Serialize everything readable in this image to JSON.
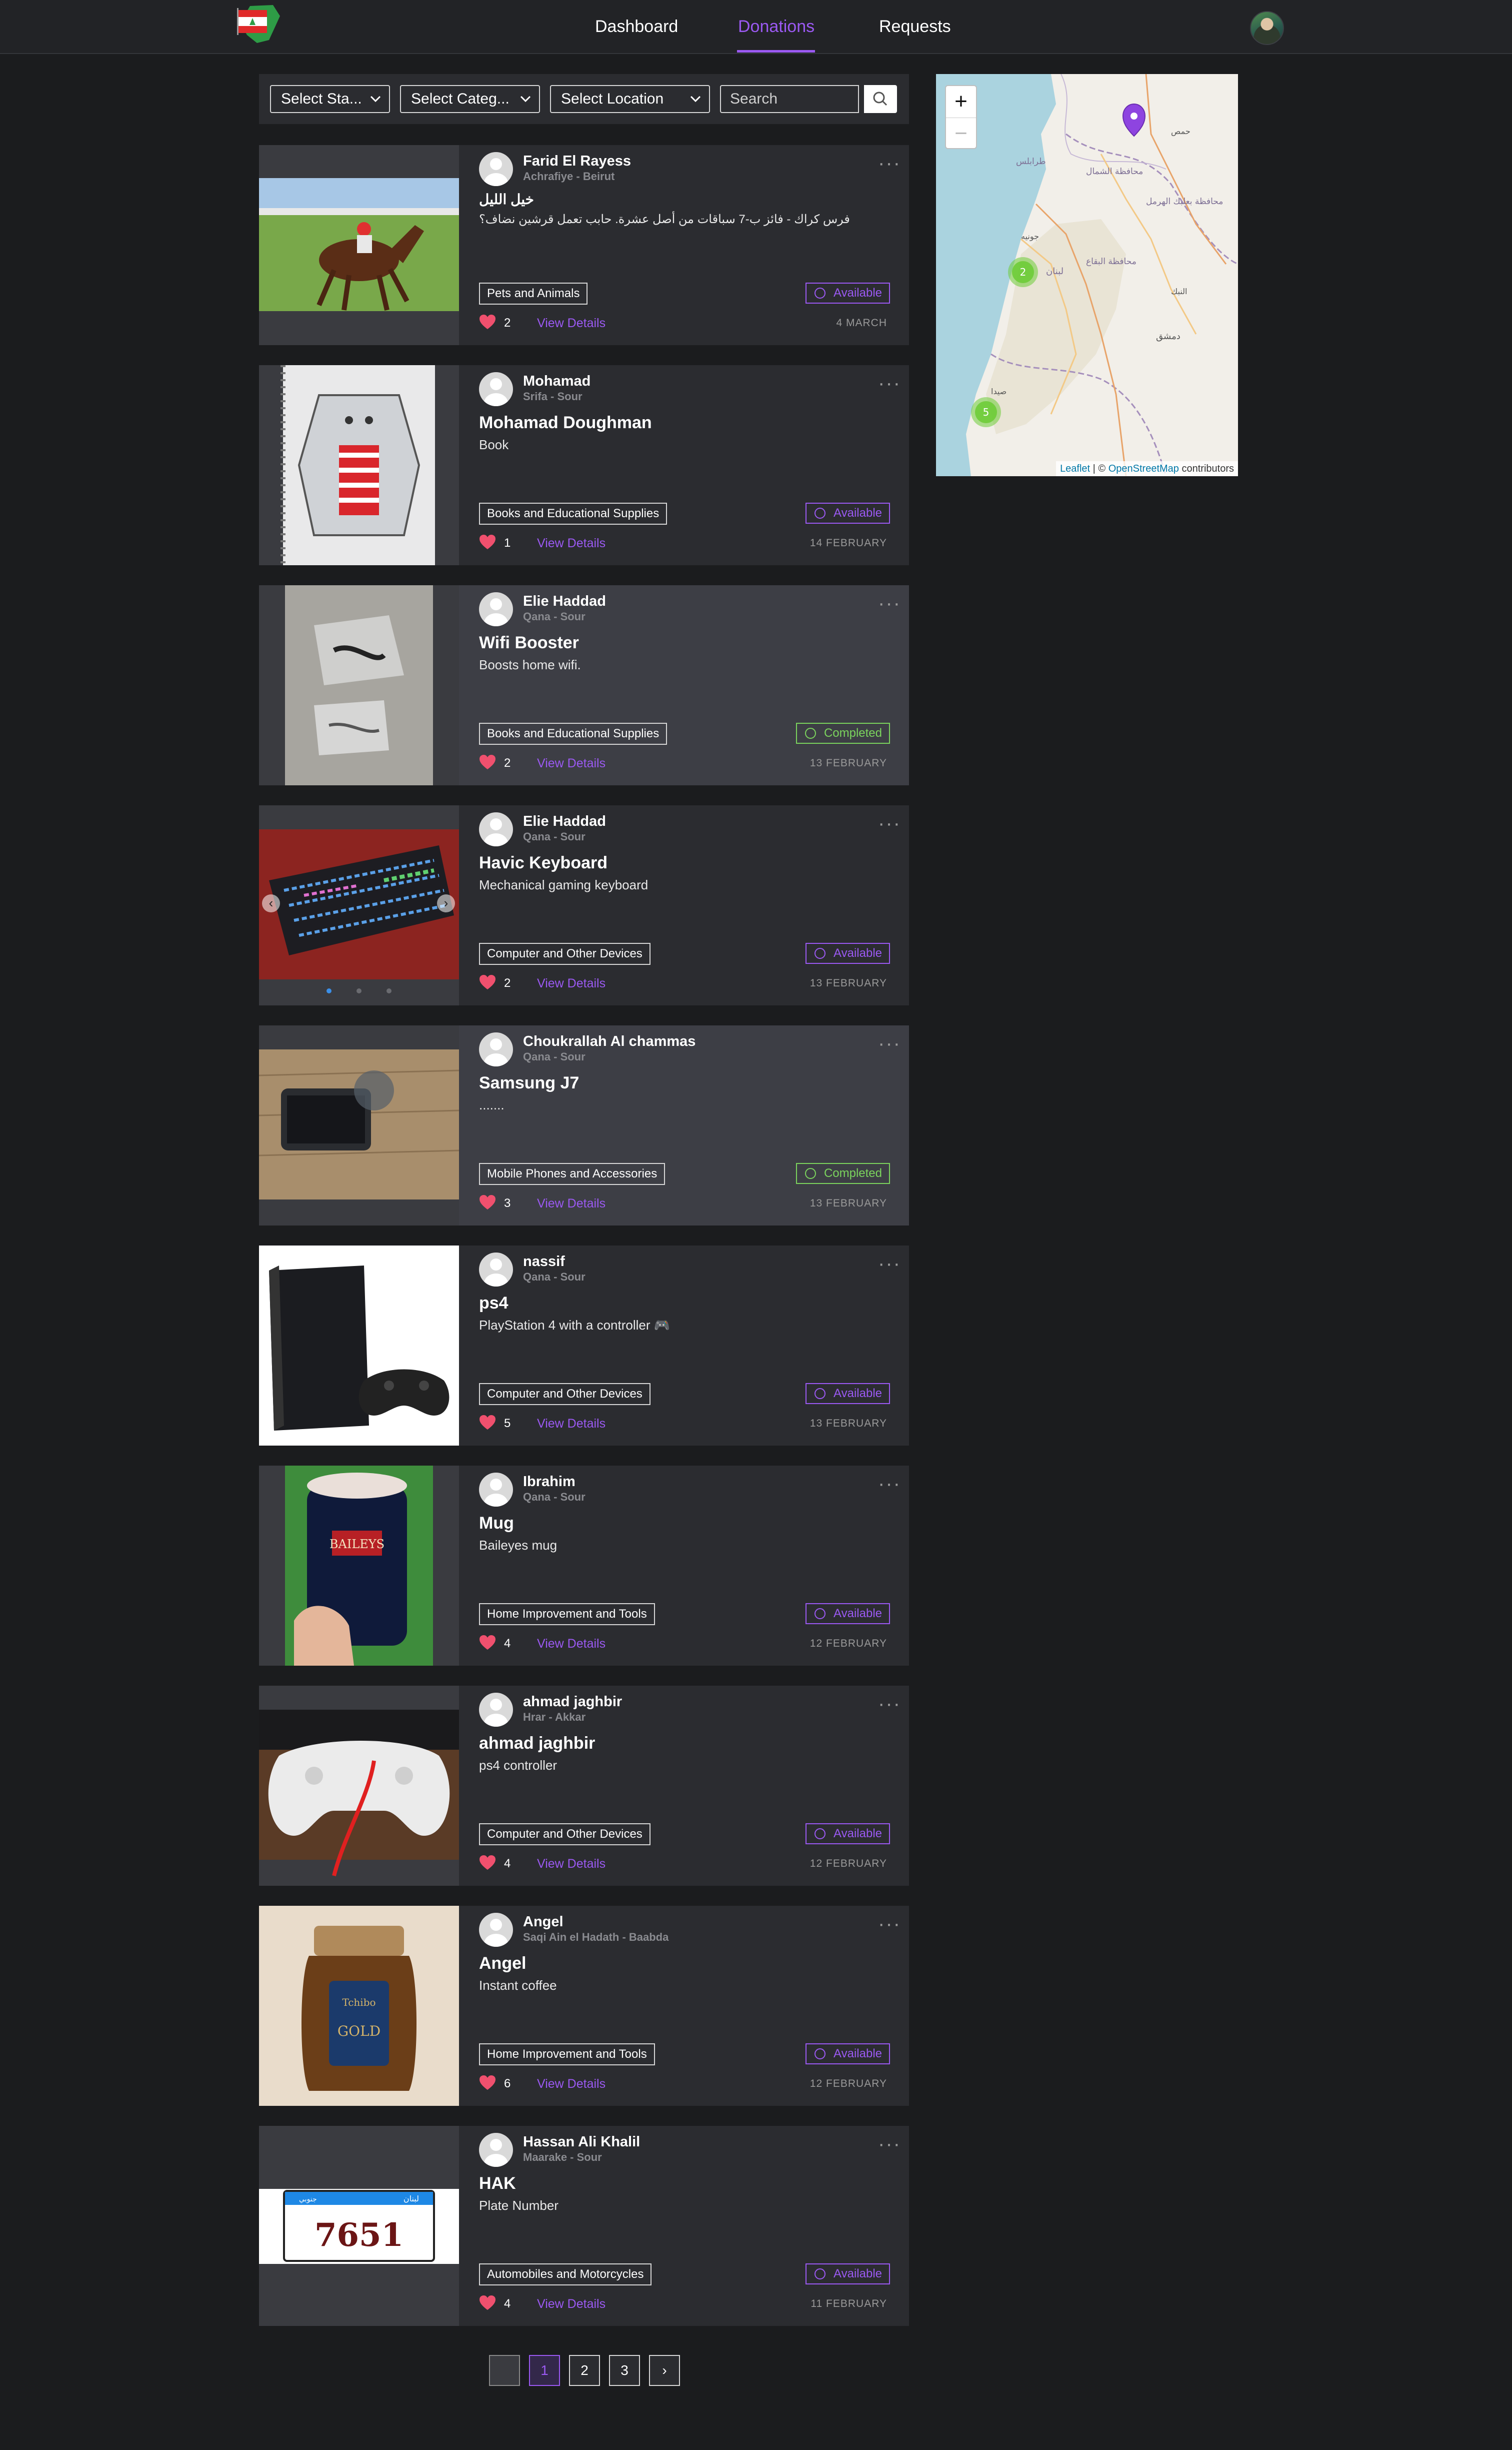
{
  "nav": {
    "links": [
      "Dashboard",
      "Donations",
      "Requests"
    ],
    "active": "Donations"
  },
  "filters": {
    "status_label": "Select Sta...",
    "category_label": "Select Categ...",
    "location_label": "Select Location",
    "search_placeholder": "Search"
  },
  "map": {
    "zoom_in": "+",
    "zoom_out": "−",
    "cluster_counts": [
      "2",
      "5"
    ],
    "attribution": {
      "leaflet": "Leaflet",
      "sep": " | © ",
      "osm": "OpenStreetMap",
      "suffix": " contributors"
    },
    "place_labels": [
      "لبنان",
      "دمشق",
      "محافظة الشمال",
      "محافظة بعلبك الهرمل",
      "محافظة البقاع",
      "جونيه",
      "طرابلس",
      "صيدا",
      "النبك",
      "حمص"
    ]
  },
  "donations": [
    {
      "user": "Farid El Rayess",
      "location": "Achrafiye - Beirut",
      "title": "خيل الليل",
      "description": "فرس كراك - فائز ب-7 سباقات من أصل عشرة. حابب تعمل قرشين نضاف؟",
      "category": "Pets and Animals",
      "status": "Available",
      "likes": "2",
      "date": "4 MARCH",
      "action": "View Details"
    },
    {
      "user": "Mohamad",
      "location": "Srifa - Sour",
      "title": "Mohamad Doughman",
      "description": "Book",
      "category": "Books and Educational Supplies",
      "status": "Available",
      "likes": "1",
      "date": "14 FEBRUARY",
      "action": "View Details"
    },
    {
      "user": "Elie Haddad",
      "location": "Qana - Sour",
      "title": "Wifi Booster",
      "description": "Boosts home wifi.",
      "category": "Books and Educational Supplies",
      "status": "Completed",
      "likes": "2",
      "date": "13 FEBRUARY",
      "action": "View Details"
    },
    {
      "user": "Elie Haddad",
      "location": "Qana - Sour",
      "title": "Havic Keyboard",
      "description": "Mechanical gaming keyboard",
      "category": "Computer and Other Devices",
      "status": "Available",
      "likes": "2",
      "date": "13 FEBRUARY",
      "action": "View Details"
    },
    {
      "user": "Choukrallah Al chammas",
      "location": "Qana - Sour",
      "title": "Samsung J7",
      "description": ".......",
      "category": "Mobile Phones and Accessories",
      "status": "Completed",
      "likes": "3",
      "date": "13 FEBRUARY",
      "action": "View Details"
    },
    {
      "user": "nassif",
      "location": "Qana - Sour",
      "title": "ps4",
      "description": "PlayStation 4 with a controller 🎮",
      "category": "Computer and Other Devices",
      "status": "Available",
      "likes": "5",
      "date": "13 FEBRUARY",
      "action": "View Details"
    },
    {
      "user": "Ibrahim",
      "location": "Qana - Sour",
      "title": "Mug",
      "description": "Baileyes mug",
      "category": "Home Improvement and Tools",
      "status": "Available",
      "likes": "4",
      "date": "12 FEBRUARY",
      "action": "View Details"
    },
    {
      "user": "ahmad jaghbir",
      "location": "Hrar - Akkar",
      "title": "ahmad jaghbir",
      "description": "ps4 controller",
      "category": "Computer and Other Devices",
      "status": "Available",
      "likes": "4",
      "date": "12 FEBRUARY",
      "action": "View Details"
    },
    {
      "user": "Angel",
      "location": "Saqi Ain el Hadath - Baabda",
      "title": "Angel",
      "description": "Instant coffee",
      "category": "Home Improvement and Tools",
      "status": "Available",
      "likes": "6",
      "date": "12 FEBRUARY",
      "action": "View Details"
    },
    {
      "user": "Hassan Ali Khalil",
      "location": "Maarake - Sour",
      "title": "HAK",
      "description": "Plate Number",
      "category": "Automobiles and Motorcycles",
      "status": "Available",
      "likes": "4",
      "date": "11 FEBRUARY",
      "action": "View Details"
    }
  ],
  "image_text": {
    "mug_brand": "BAILEYS",
    "coffee_brand": "Tchibo",
    "coffee_label": "GOLD",
    "plate_number": "7651",
    "plate_country": "لبنان",
    "plate_region": "جنوبي"
  },
  "pagination": {
    "pages": [
      "1",
      "2",
      "3"
    ],
    "next": "›",
    "current": "1"
  },
  "colors": {
    "accent": "#9b59f2",
    "completed": "#7bd35d",
    "heart": "#f0506e",
    "background": "#1b1c1e",
    "card": "#2b2c30"
  }
}
